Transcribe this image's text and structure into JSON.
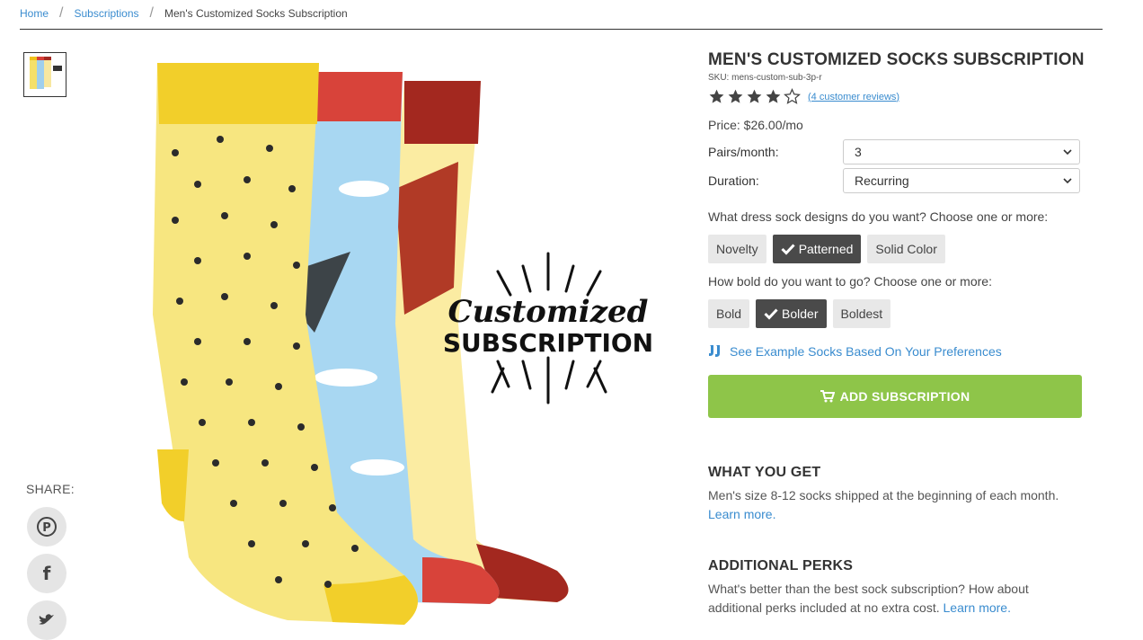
{
  "breadcrumb": {
    "home": "Home",
    "subscriptions": "Subscriptions",
    "current": "Men's Customized Socks Subscription",
    "separator": "/"
  },
  "product": {
    "title": "MEN'S CUSTOMIZED SOCKS SUBSCRIPTION",
    "sku": "SKU: mens-custom-sub-3p-r",
    "rating": 4,
    "rating_max": 5,
    "reviews_label": "(4 customer reviews)",
    "price": "Price: $26.00/mo",
    "image_text": {
      "line1": "Customized",
      "line2": "SUBSCRIPTION"
    }
  },
  "options": {
    "pairs_label": "Pairs/month:",
    "pairs_value": "3",
    "duration_label": "Duration:",
    "duration_value": "Recurring"
  },
  "designs": {
    "question": "What dress sock designs do you want? Choose one or more:",
    "choices": [
      "Novelty",
      "Patterned",
      "Solid Color"
    ],
    "selected": "Patterned"
  },
  "boldness": {
    "question": "How bold do you want to go? Choose one or more:",
    "choices": [
      "Bold",
      "Bolder",
      "Boldest"
    ],
    "selected": "Bolder"
  },
  "example_link": "See Example Socks Based On Your Preferences",
  "add_button": "ADD SUBSCRIPTION",
  "what_you_get": {
    "title": "WHAT YOU GET",
    "text": "Men's size 8-12 socks shipped at the beginning of each month.",
    "link": "Learn more."
  },
  "perks": {
    "title": "ADDITIONAL PERKS",
    "text": "What's better than the best sock subscription? How about additional perks included at no extra cost.",
    "link": "Learn more."
  },
  "share": {
    "label": "SHARE:",
    "icons": [
      "pinterest-icon",
      "facebook-icon",
      "twitter-icon"
    ]
  },
  "colors": {
    "link": "#3a8ccf",
    "add_button": "#8ec549",
    "selected_chip": "#4a4a4a"
  }
}
